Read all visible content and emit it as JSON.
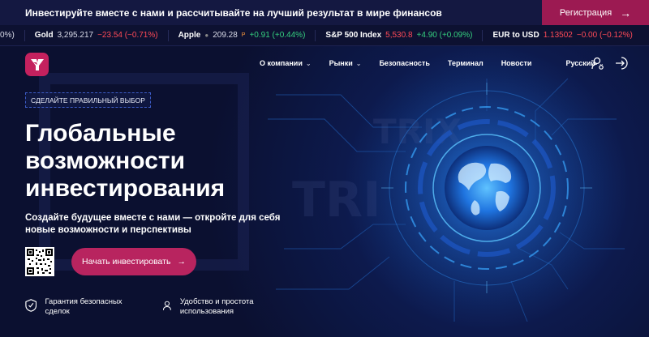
{
  "promo": {
    "text": "Инвестируйте вместе с нами и рассчитывайте на лучший результат в мире финансов",
    "button_label": "Регистрация"
  },
  "ticker": [
    {
      "name": "",
      "price": "",
      "change": "0%)",
      "change_color": "red"
    },
    {
      "name": "Gold",
      "price": "3,295.217",
      "change": "−23.54 (−0.71%)",
      "change_color": "red"
    },
    {
      "name": "Apple",
      "price": "209.28",
      "marker": "P",
      "change": "+0.91 (+0.44%)",
      "change_color": "green"
    },
    {
      "name": "S&P 500 Index",
      "price": "5,530.8",
      "price_color": "red",
      "change": "+4.90 (+0.09%)",
      "change_color": "green"
    },
    {
      "name": "EUR to USD",
      "price": "1.13502",
      "price_color": "red",
      "change": "−0.00 (−0.12%)",
      "change_color": "red"
    }
  ],
  "nav": {
    "items": [
      "О компании",
      "Рынки",
      "Безопасность",
      "Терминал",
      "Новости"
    ],
    "language": "Русский"
  },
  "hero": {
    "badge": "СДЕЛАЙТЕ ПРАВИЛЬНЫЙ ВЫБОР",
    "title": "Глобальные возможности инвестирования",
    "subtitle": "Создайте будущее вместе с нами — откройте для себя новые возможности и перспективы",
    "cta_label": "Начать инвестировать",
    "features": [
      {
        "label": "Гарантия безопасных сделок",
        "icon": "shield-icon"
      },
      {
        "label": "Удобство и простота использования",
        "icon": "user-icon"
      }
    ]
  },
  "colors": {
    "brand": "#c4215e",
    "cta": "#b8245f",
    "background": "#0b1030",
    "negative": "#ff4a57",
    "positive": "#35d07f"
  }
}
